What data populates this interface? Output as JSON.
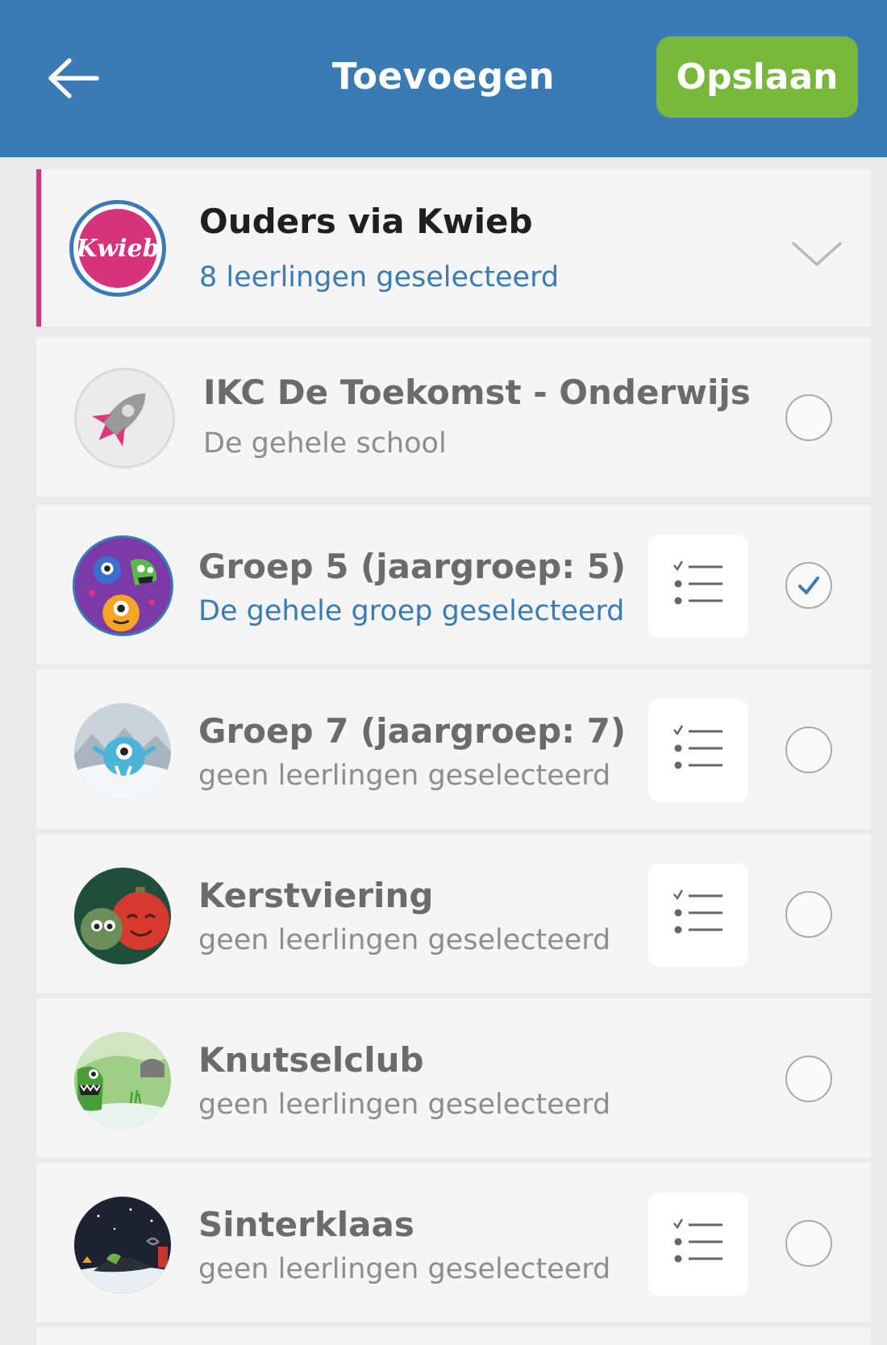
{
  "header": {
    "title": "Toevoegen",
    "save_label": "Opslaan"
  },
  "colors": {
    "header_bg": "#3a7bb5",
    "save_bg": "#77b83a",
    "accent_pink": "#d6337a",
    "link_blue": "#3a7bb5"
  },
  "parents": {
    "logo_text": "Kwieb",
    "title": "Ouders via Kwieb",
    "subtitle": "8 leerlingen geselecteerd"
  },
  "school": {
    "title": "IKC De Toekomst - Onderwijs",
    "subtitle": "De gehele school",
    "selected": false
  },
  "groups": [
    {
      "title": "Groep 5 (jaargroep: 5)",
      "subtitle": "De gehele groep geselecteerd",
      "selected": true,
      "has_list_button": true,
      "avatar": "monsters-purple"
    },
    {
      "title": "Groep 7 (jaargroep: 7)",
      "subtitle": "geen leerlingen geselecteerd",
      "selected": false,
      "has_list_button": true,
      "avatar": "yeti-snow"
    },
    {
      "title": "Kerstviering",
      "subtitle": "geen leerlingen geselecteerd",
      "selected": false,
      "has_list_button": true,
      "avatar": "christmas-baubles"
    },
    {
      "title": "Knutselclub",
      "subtitle": "geen leerlingen geselecteerd",
      "selected": false,
      "has_list_button": false,
      "avatar": "green-monster-landscape"
    },
    {
      "title": "Sinterklaas",
      "subtitle": "geen leerlingen geselecteerd",
      "selected": false,
      "has_list_button": true,
      "avatar": "night-sinterklaas"
    }
  ],
  "icons": {
    "back": "arrow-left-icon",
    "expand": "chevron-down-icon",
    "list": "checklist-icon",
    "checked": "checkmark-icon"
  }
}
